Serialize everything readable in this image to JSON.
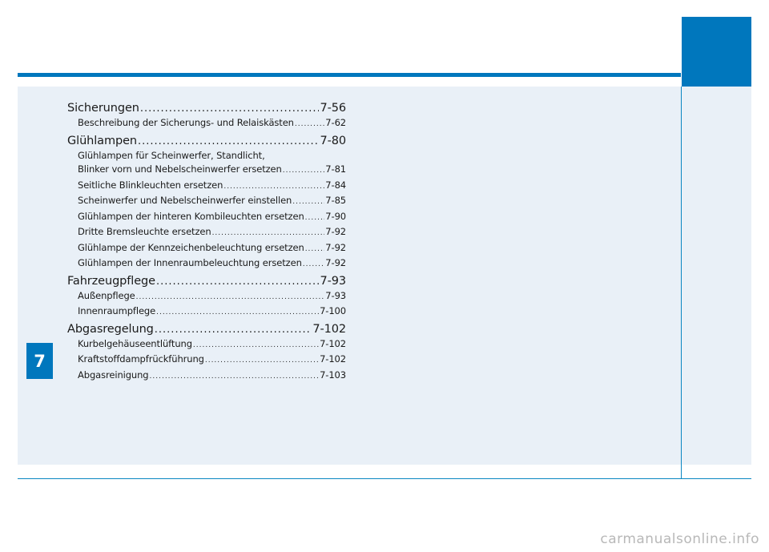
{
  "chapter": "7",
  "toc": {
    "sections": [
      {
        "title": "Sicherungen",
        "page": "7-56",
        "items": [
          {
            "title": "Beschreibung der Sicherungs- und Relaiskästen",
            "page": "7-62"
          }
        ]
      },
      {
        "title": "Glühlampen",
        "page": "7-80",
        "items": [
          {
            "title_line1": "Glühlampen für Scheinwerfer, Standlicht,",
            "title": "Blinker vorn und Nebelscheinwerfer ersetzen",
            "page": "7-81"
          },
          {
            "title": "Seitliche Blinkleuchten ersetzen",
            "page": "7-84"
          },
          {
            "title": "Scheinwerfer und Nebelscheinwerfer einstellen",
            "page": "7-85"
          },
          {
            "title": "Glühlampen der hinteren Kombileuchten ersetzen",
            "page": "7-90"
          },
          {
            "title": "Dritte Bremsleuchte ersetzen",
            "page": "7-92"
          },
          {
            "title": "Glühlampe der Kennzeichenbeleuchtung ersetzen",
            "page": "7-92"
          },
          {
            "title": "Glühlampen der Innenraumbeleuchtung ersetzen",
            "page": "7-92"
          }
        ]
      },
      {
        "title": "Fahrzeugpflege",
        "page": "7-93",
        "items": [
          {
            "title": "Außenpflege",
            "page": "7-93"
          },
          {
            "title": "Innenraumpflege",
            "page": "7-100"
          }
        ]
      },
      {
        "title": "Abgasregelung",
        "page": "7-102",
        "items": [
          {
            "title": "Kurbelgehäuseentlüftung",
            "page": "7-102"
          },
          {
            "title": "Kraftstoffdampfrückführung",
            "page": "7-102"
          },
          {
            "title": "Abgasreinigung",
            "page": "7-103"
          }
        ]
      }
    ]
  },
  "watermark": "carmanualsonline.info",
  "colors": {
    "accent": "#0077bd",
    "panel": "#e9f0f7"
  }
}
